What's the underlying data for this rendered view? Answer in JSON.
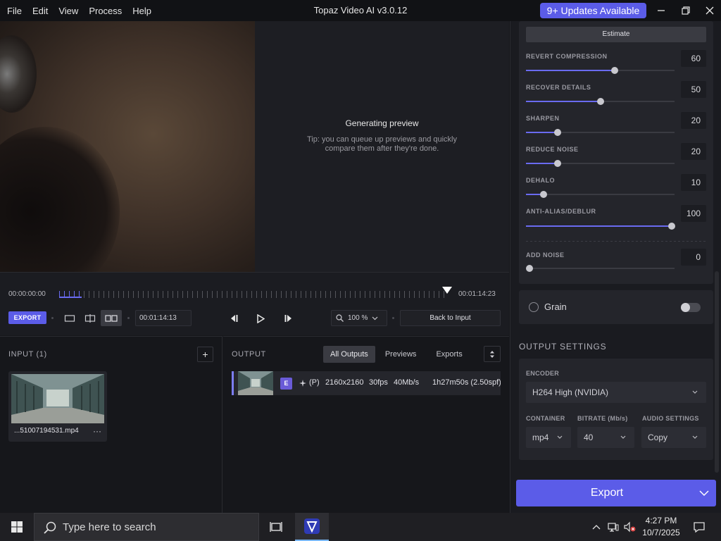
{
  "menu": [
    "File",
    "Edit",
    "View",
    "Process",
    "Help"
  ],
  "app_title": "Topaz Video AI  v3.0.12",
  "updates_label": "9+ Updates Available",
  "preview": {
    "status": "Generating preview",
    "tip": "Tip: you can queue up previews and quickly compare them after they're done."
  },
  "timeline": {
    "start_time": "00:00:00:00",
    "end_time": "00:01:14:23",
    "current_time": "00:01:14:13",
    "export_label": "EXPORT",
    "zoom": "100 %",
    "back_label": "Back to Input"
  },
  "input_panel": {
    "title": "INPUT (1)",
    "add": "+",
    "file_name": "...51007194531.mp4",
    "more": "···"
  },
  "output_panel": {
    "title": "OUTPUT",
    "tabs": [
      "All Outputs",
      "Previews",
      "Exports"
    ],
    "row": {
      "badge": "E",
      "preset": "(P)",
      "resolution": "2160x2160",
      "fps": "30fps",
      "bitrate": "40Mb/s",
      "duration": "1h27m50s (2.50spf)"
    }
  },
  "enhance": {
    "estimate_label": "Estimate",
    "sliders": [
      {
        "label": "REVERT COMPRESSION",
        "value": "60",
        "level": 0.6
      },
      {
        "label": "RECOVER DETAILS",
        "value": "50",
        "level": 0.5
      },
      {
        "label": "SHARPEN",
        "value": "20",
        "level": 0.2
      },
      {
        "label": "REDUCE NOISE",
        "value": "20",
        "level": 0.2
      },
      {
        "label": "DEHALO",
        "value": "10",
        "level": 0.1
      },
      {
        "label": "ANTI-ALIAS/DEBLUR",
        "value": "100",
        "level": 1.0
      }
    ],
    "add_noise": {
      "label": "ADD NOISE",
      "value": "0",
      "level": 0.0
    }
  },
  "grain": {
    "label": "Grain",
    "enabled": false
  },
  "output_settings": {
    "title": "OUTPUT SETTINGS",
    "encoder_label": "ENCODER",
    "encoder_value": "H264 High (NVIDIA)",
    "container_label": "CONTAINER",
    "container_value": "mp4",
    "bitrate_label": "BITRATE (Mb/s)",
    "bitrate_value": "40",
    "audio_label": "AUDIO SETTINGS",
    "audio_value": "Copy"
  },
  "export_button": "Export",
  "taskbar": {
    "search_placeholder": "Type here to search",
    "time": "4:27 PM",
    "date": "10/7/2025"
  },
  "colors": {
    "accent": "#5b5ce8",
    "slider_fill": "#6a6bf0",
    "panel": "#24252b",
    "background": "#16171b"
  }
}
